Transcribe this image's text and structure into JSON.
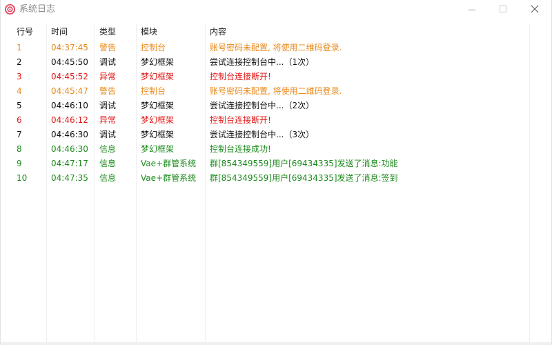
{
  "window": {
    "title": "系统日志"
  },
  "table": {
    "headers": {
      "id": "行号",
      "time": "时间",
      "type": "类型",
      "module": "模块",
      "content": "内容"
    },
    "rows": [
      {
        "id": "1",
        "time": "04:37:45",
        "type": "警告",
        "module": "控制台",
        "content": " 账号密码未配置, 将使用二维码登录.",
        "color": "#e8891a"
      },
      {
        "id": "2",
        "time": "04:45:50",
        "type": "调试",
        "module": "梦幻框架",
        "content": "尝试连接控制台中...（1次）",
        "color": "#111111"
      },
      {
        "id": "3",
        "time": "04:45:52",
        "type": "异常",
        "module": "梦幻框架",
        "content": "控制台连接断开!",
        "color": "#e01818"
      },
      {
        "id": "4",
        "time": "04:45:47",
        "type": "警告",
        "module": "控制台",
        "content": " 账号密码未配置, 将使用二维码登录.",
        "color": "#e8891a"
      },
      {
        "id": "5",
        "time": "04:46:10",
        "type": "调试",
        "module": "梦幻框架",
        "content": "尝试连接控制台中...（2次）",
        "color": "#111111"
      },
      {
        "id": "6",
        "time": "04:46:12",
        "type": "异常",
        "module": "梦幻框架",
        "content": "控制台连接断开!",
        "color": "#e01818"
      },
      {
        "id": "7",
        "time": "04:46:30",
        "type": "调试",
        "module": "梦幻框架",
        "content": "尝试连接控制台中...（3次）",
        "color": "#111111"
      },
      {
        "id": "8",
        "time": "04:46:30",
        "type": "信息",
        "module": "梦幻框架",
        "content": "控制台连接成功!",
        "color": "#1c8a1c"
      },
      {
        "id": "9",
        "time": "04:47:17",
        "type": "信息",
        "module": "Vae+群管系统",
        "content": " 群[854349559]用户[69434335]发送了消息:功能",
        "color": "#1c8a1c"
      },
      {
        "id": "10",
        "time": "04:47:35",
        "type": "信息",
        "module": "Vae+群管系统",
        "content": " 群[854349559]用户[69434335]发送了消息:签到",
        "color": "#1c8a1c"
      }
    ]
  },
  "icons": {
    "app": "app-logo-icon",
    "minimize": "minimize-icon",
    "maximize": "maximize-icon",
    "close": "close-icon"
  }
}
